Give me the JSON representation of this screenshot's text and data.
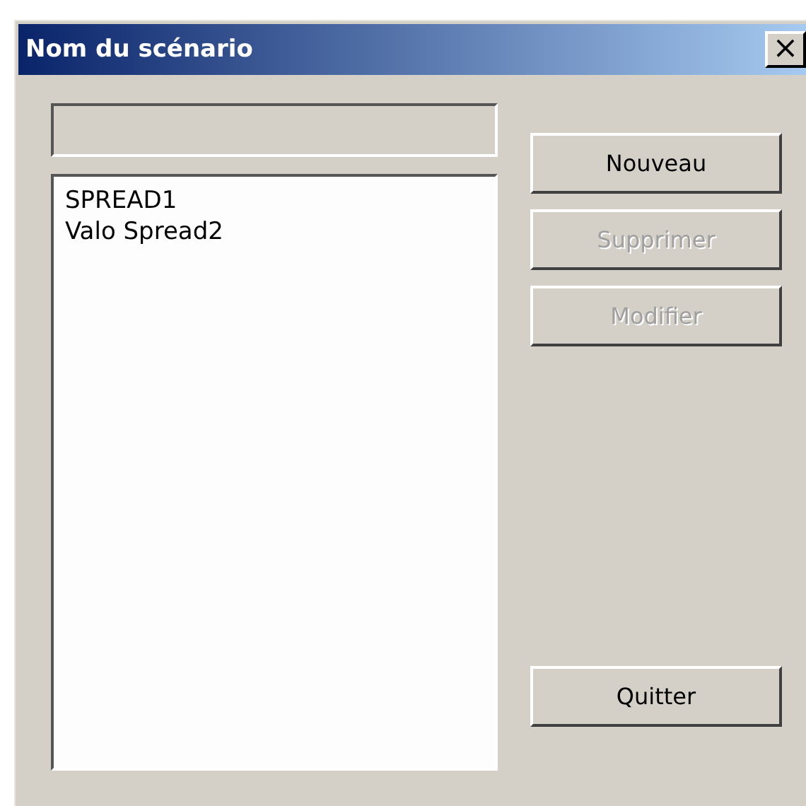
{
  "window": {
    "title": "Nom du scénario",
    "close_label": "×"
  },
  "name_field": {
    "disabled": true
  },
  "list": {
    "items": [
      {
        "label": "SPREAD1",
        "selected": false
      },
      {
        "label": "Valo Spread2",
        "selected": false
      }
    ]
  },
  "buttons": [
    {
      "label": "Nouveau",
      "disabled": false
    },
    {
      "label": "Supprimer",
      "disabled": true
    },
    {
      "label": "Modifier",
      "disabled": true
    }
  ],
  "footer_buttons": [
    {
      "label": "Quitter",
      "disabled": false
    }
  ]
}
